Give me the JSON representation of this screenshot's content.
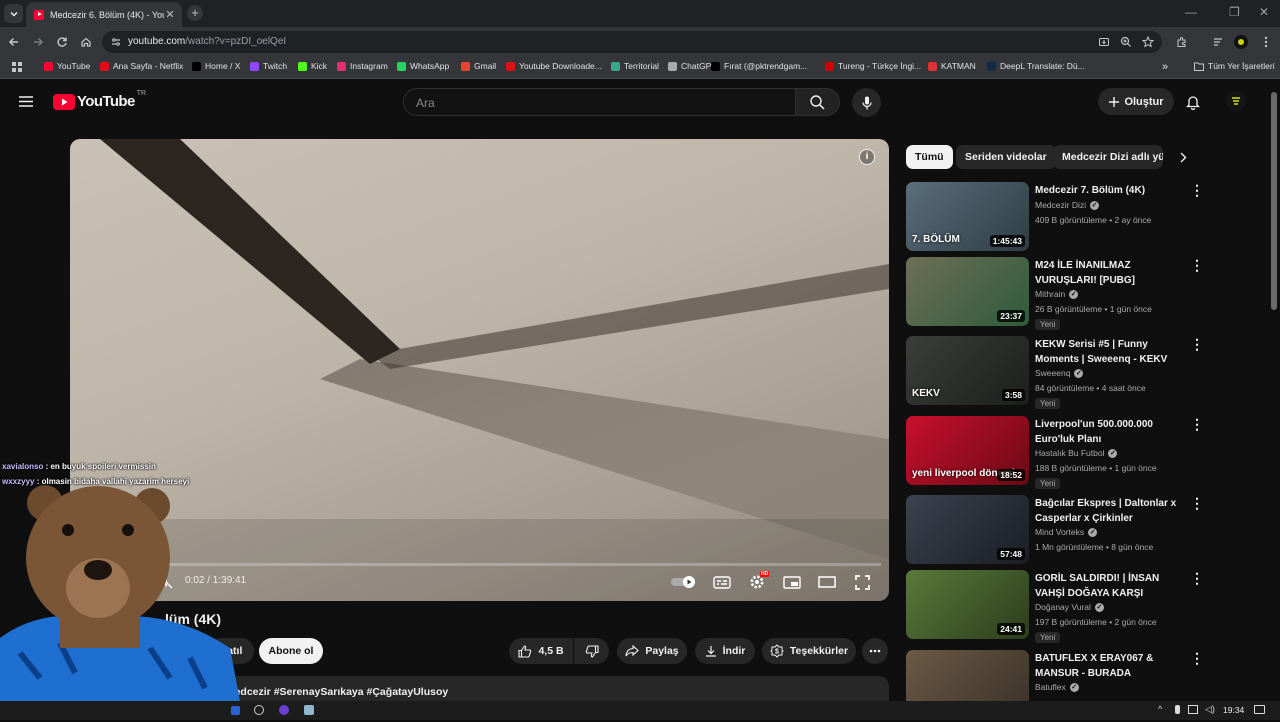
{
  "browser": {
    "tab_title": "Medcezir 6. Bölüm (4K) - YouTube",
    "url_host": "youtube.com",
    "url_path": "/watch?v=pzDI_oelQeI",
    "bookmarks": [
      "YouTube",
      "Ana Sayfa - Netflix",
      "Home / X",
      "Twitch",
      "Kick",
      "Instagram",
      "WhatsApp",
      "Gmail",
      "Youtube Downloade...",
      "Territorial",
      "ChatGPT",
      "Fırat (@pktrendgam...",
      "Tureng - Türkçe İngi...",
      "KATMAN",
      "DeepL Translate: Dü..."
    ],
    "bookmark_colors": [
      "#ff0033",
      "#e50914",
      "#000000",
      "#9146ff",
      "#53fc18",
      "#e1306c",
      "#25d366",
      "#ea4335",
      "#d11",
      "#3a8",
      "#aaa",
      "#000",
      "#c00",
      "#d33",
      "#0f2b46"
    ],
    "all_bookmarks": "Tüm Yer İşaretleri"
  },
  "yt": {
    "logo": "YouTube",
    "region": "TR",
    "search_placeholder": "Ara",
    "create_label": "Oluştur"
  },
  "player": {
    "time": "0:02 / 1:39:41",
    "progress_fraction": 0.0003,
    "settings_badge": "HD"
  },
  "video": {
    "title_visible": "lüm (4K)",
    "join_label": "Katıl",
    "subscribe_label": "Abone ol",
    "likes": "4,5 B",
    "share_label": "Paylaş",
    "download_label": "İndir",
    "thanks_label": "Teşekkürler",
    "hashtags": "#Medcezir #SerenaySarıkaya #ÇağatayUlusoy"
  },
  "chips": [
    "Tümü",
    "Seriden videolar",
    "Medcezir Dizi adlı yük"
  ],
  "recs": [
    {
      "title": "Medcezir 7. Bölüm (4K)",
      "channel": "Medcezir Dizi",
      "meta": "409 B görüntüleme • 2 ay önce",
      "duration": "1:45:43",
      "new": "",
      "thumb_text": "7. BÖLÜM",
      "colors": [
        "#5a6e7c",
        "#2f3d45"
      ]
    },
    {
      "title": "M24 İLE İNANILMAZ VURUŞLARI! [PUBG]",
      "channel": "Mithrain",
      "meta": "26 B görüntüleme • 1 gün önce",
      "duration": "23:37",
      "new": "Yeni",
      "thumb_text": "",
      "colors": [
        "#6d6f55",
        "#2f5b3c"
      ]
    },
    {
      "title": "KEKW Serisi #5 | Funny Moments | Sweeenq - KEKV",
      "channel": "Sweeenq",
      "meta": "84 görüntüleme • 4 saat önce",
      "duration": "3:58",
      "new": "Yeni",
      "thumb_text": "KEKV",
      "colors": [
        "#3a3f3a",
        "#1c1f1c"
      ]
    },
    {
      "title": "Liverpool'un 500.000.000 Euro'luk Planı",
      "channel": "Hastalık Bu Futbol",
      "meta": "188 B görüntüleme • 1 gün önce",
      "duration": "18:52",
      "new": "Yeni",
      "thumb_text": "yeni liverpool dönemi",
      "colors": [
        "#c8102e",
        "#6a0a14"
      ]
    },
    {
      "title": "Bağcılar Ekspres | Daltonlar x Casperlar x Çirkinler",
      "channel": "Mind Vorteks",
      "meta": "1 Mn görüntüleme • 8 gün önce",
      "duration": "57:48",
      "new": "",
      "thumb_text": "",
      "colors": [
        "#3d4250",
        "#1a1d24"
      ]
    },
    {
      "title": "GORİL SALDIRDI! | İNSAN VAHŞİ DOĞAYA KARŞI",
      "channel": "Doğanay Vural",
      "meta": "197 B görüntüleme • 2 gün önce",
      "duration": "24:41",
      "new": "Yeni",
      "thumb_text": "",
      "colors": [
        "#5a7a3a",
        "#2b3d1c"
      ]
    },
    {
      "title": "BATUFLEX X ERAY067 & MANSUR - BURADA SOKAKLA...",
      "channel": "Batuflex",
      "meta": "",
      "duration": "",
      "new": "",
      "thumb_text": "",
      "colors": [
        "#6b5a45",
        "#3a3128"
      ]
    }
  ],
  "chat": [
    {
      "user": "xavialonso",
      "text": " : en buyuk spoileri vermissin"
    },
    {
      "user": "wxxzyyy",
      "text": " : olmasin bidaha vallahi yazarim herseyi"
    }
  ],
  "taskbar": {
    "time": "19:34"
  }
}
